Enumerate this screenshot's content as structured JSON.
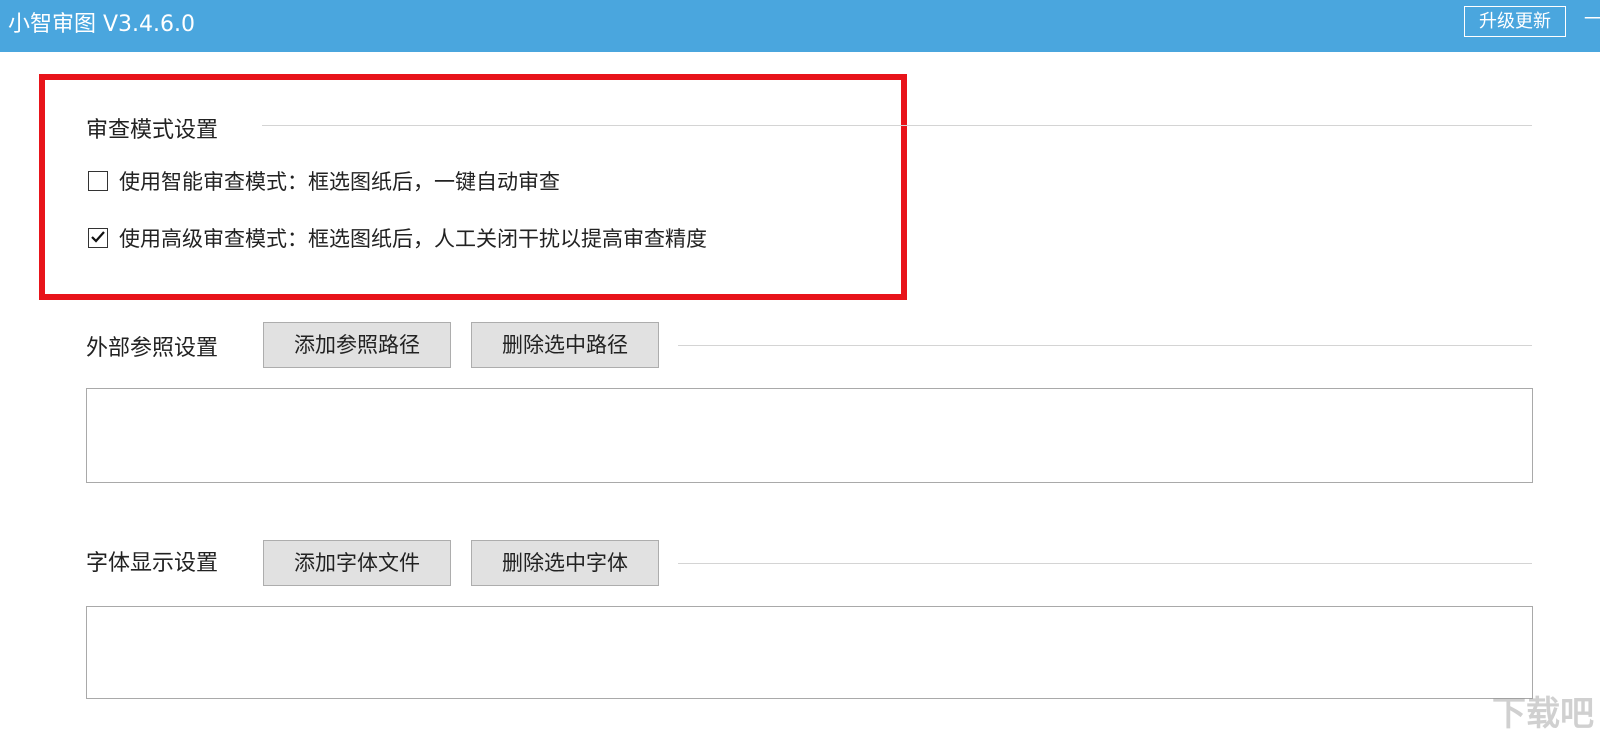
{
  "window": {
    "title": "小智审图 V3.4.6.0",
    "upgrade_label": "升级更新",
    "title_extra": "一"
  },
  "review_mode": {
    "title": "审查模式设置",
    "options": [
      {
        "label": "使用智能审查模式：框选图纸后，一键自动审查",
        "checked": false
      },
      {
        "label": "使用高级审查模式：框选图纸后，人工关闭干扰以提高审查精度",
        "checked": true
      }
    ]
  },
  "external_ref": {
    "title": "外部参照设置",
    "add_label": "添加参照路径",
    "delete_label": "删除选中路径",
    "items": []
  },
  "font_display": {
    "title": "字体显示设置",
    "add_label": "添加字体文件",
    "delete_label": "删除选中字体",
    "items": []
  },
  "watermark": {
    "text": "下载吧"
  },
  "colors": {
    "titlebar": "#4aa6de",
    "highlight": "#e8141a",
    "button": "#e1e1e1"
  }
}
